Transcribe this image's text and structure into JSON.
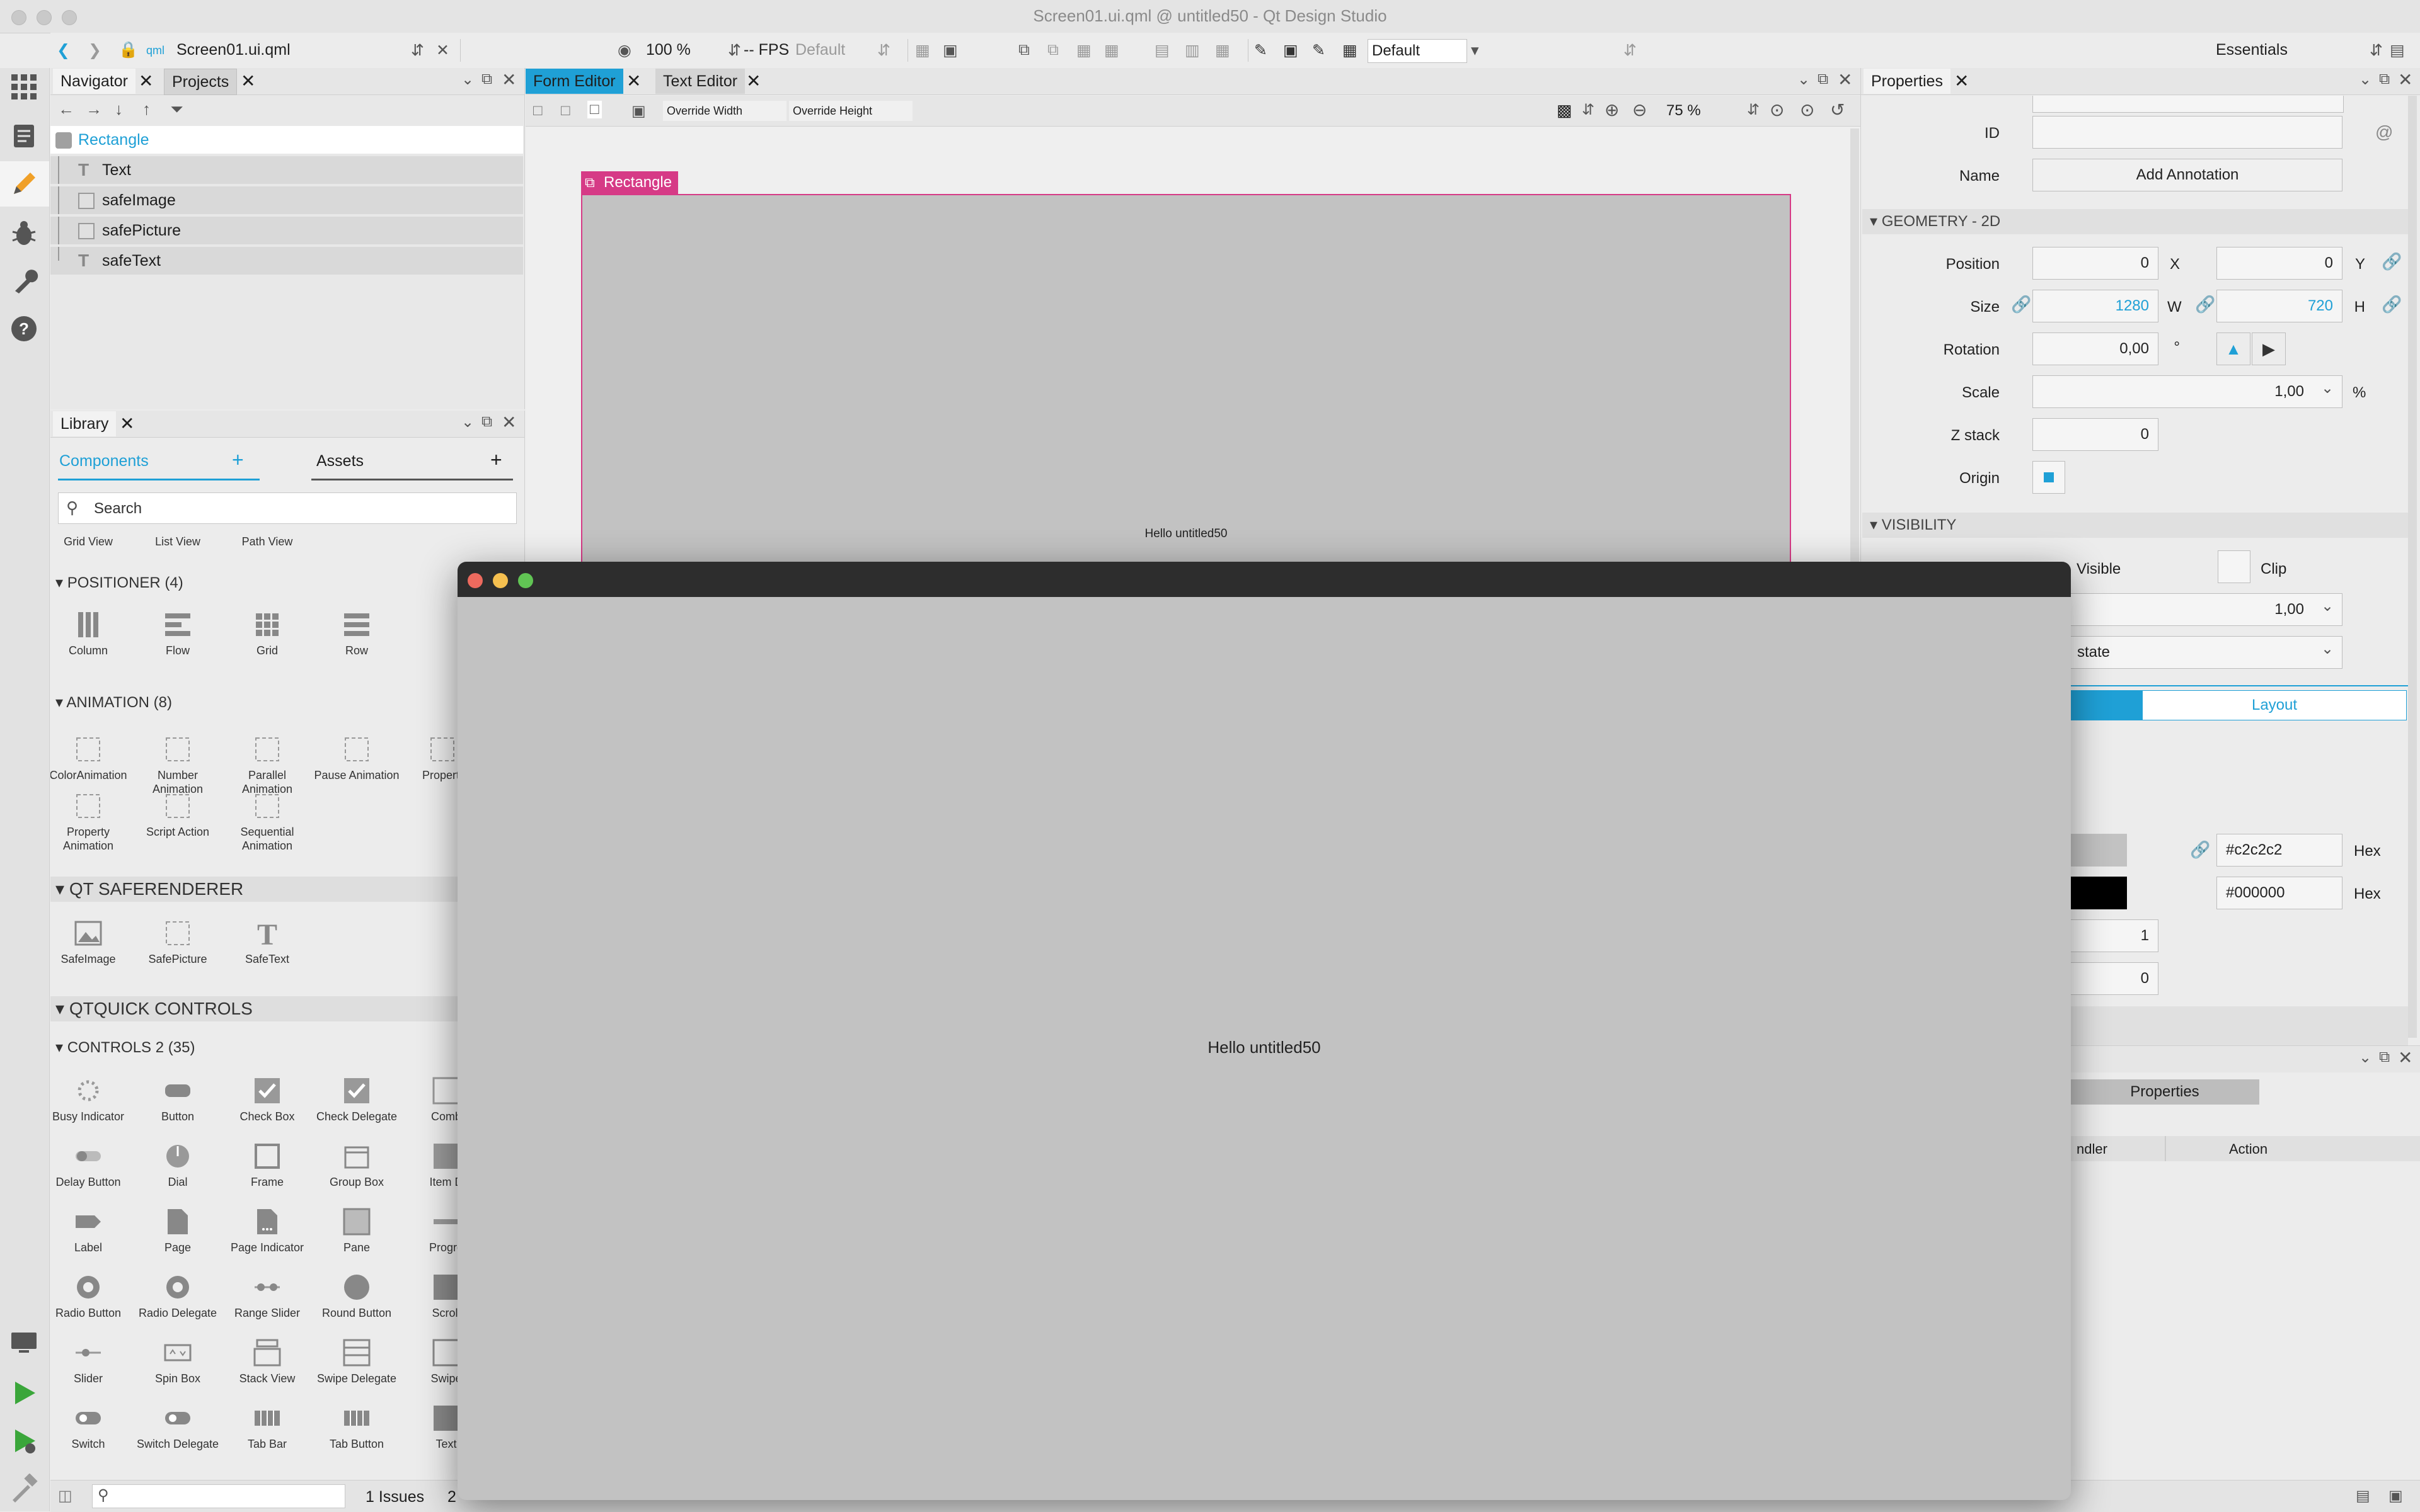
{
  "window": {
    "title": "Screen01.ui.qml @ untitled50 - Qt Design Studio"
  },
  "toolbar": {
    "file_name": "Screen01.ui.qml",
    "zoom": "100 %",
    "fps": "-- FPS",
    "fps_mode": "Default",
    "style": "Default",
    "workspace": "Essentials"
  },
  "navigator": {
    "tabs": [
      "Navigator",
      "Projects"
    ],
    "root": "Rectangle",
    "items": [
      "Text",
      "safeImage",
      "safePicture",
      "safeText"
    ]
  },
  "library": {
    "title": "Library",
    "tabs": [
      "Components",
      "Assets"
    ],
    "search_placeholder": "Search",
    "views_row": [
      "Grid View",
      "List View",
      "Path View"
    ],
    "sections": {
      "positioner": "POSITIONER (4)",
      "animation": "ANIMATION (8)",
      "saferenderer": "QT SAFERENDERER",
      "qtquick": "QTQUICK CONTROLS",
      "controls2": "CONTROLS 2 (35)"
    },
    "positioner_items": [
      "Column",
      "Flow",
      "Grid",
      "Row"
    ],
    "animation_items": [
      "ColorAnimation",
      "Number Animation",
      "Parallel Animation",
      "Pause Animation",
      "Propert",
      "Property Animation",
      "Script Action",
      "Sequential Animation"
    ],
    "saferenderer_items": [
      "SafeImage",
      "SafePicture",
      "SafeText"
    ],
    "controls_items": [
      "Busy Indicator",
      "Button",
      "Check Box",
      "Check Delegate",
      "Comb",
      "Delay Button",
      "Dial",
      "Frame",
      "Group Box",
      "Item D",
      "Label",
      "Page",
      "Page Indicator",
      "Pane",
      "Progre",
      "Radio Button",
      "Radio Delegate",
      "Range Slider",
      "Round Button",
      "Scroll",
      "Slider",
      "Spin Box",
      "Stack View",
      "Swipe Delegate",
      "Swipe",
      "Switch",
      "Switch Delegate",
      "Tab Bar",
      "Tab Button",
      "Text"
    ]
  },
  "editor": {
    "tabs": [
      "Form Editor",
      "Text Editor"
    ],
    "override_width": "Override Width",
    "override_height": "Override Height",
    "zoom": "75 %",
    "item_label": "Rectangle",
    "canvas_text": "Hello untitled50"
  },
  "properties": {
    "title": "Properties",
    "id_label": "ID",
    "name_label": "Name",
    "add_annotation": "Add Annotation",
    "geometry_section": "GEOMETRY - 2D",
    "position_label": "Position",
    "pos_x": "0",
    "pos_y": "0",
    "x_label": "X",
    "y_label": "Y",
    "size_label": "Size",
    "size_w": "1280",
    "size_h": "720",
    "w_label": "W",
    "h_label": "H",
    "rotation_label": "Rotation",
    "rotation": "0,00",
    "deg": "°",
    "scale_label": "Scale",
    "scale": "1,00",
    "percent": "%",
    "zstack_label": "Z stack",
    "zstack": "0",
    "origin_label": "Origin",
    "visibility_section": "VISIBILITY",
    "visible_label": "Visible",
    "clip_label": "Clip",
    "opacity": "1,00",
    "state_label": "state",
    "layout_tab": "Layout",
    "color_hex": "#c2c2c2",
    "border_hex": "#000000",
    "hex_label": "Hex",
    "border_width": "1",
    "radius": "0",
    "connections_tab": "Properties",
    "handler_col": "ndler",
    "action_col": "Action"
  },
  "statusbar": {
    "issues": "1 Issues",
    "partial": "2"
  },
  "preview": {
    "text": "Hello untitled50"
  },
  "colors": {
    "accent": "#1fa0d6",
    "selection": "#d63a86",
    "canvas": "#c2c2c2",
    "preview_bar": "#2d2d2d"
  }
}
